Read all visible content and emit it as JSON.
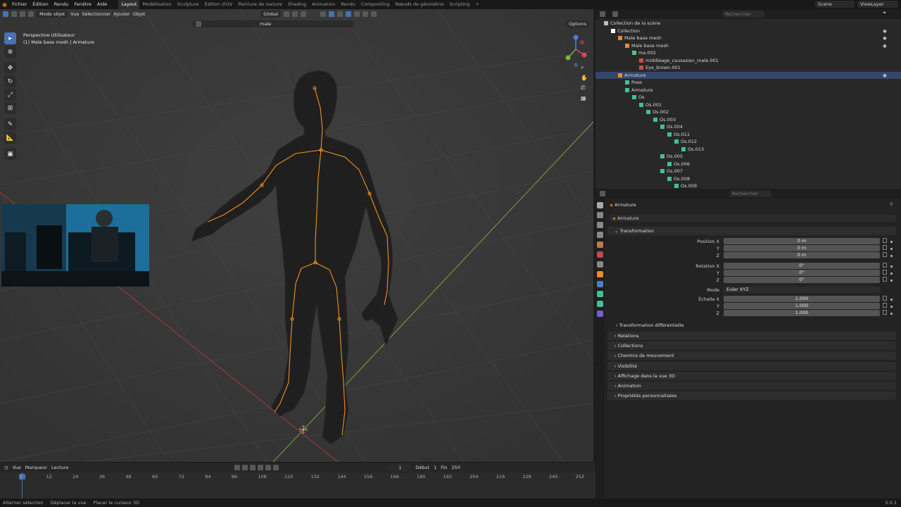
{
  "menu": [
    "Fichier",
    "Édition",
    "Rendu",
    "Fenêtre",
    "Aide"
  ],
  "workspaces": [
    "Layout",
    "Modélisation",
    "Sculpture",
    "Édition d'UV",
    "Peinture de texture",
    "Shading",
    "Animation",
    "Rendu",
    "Compositing",
    "Nœuds de géométrie",
    "Scripting"
  ],
  "active_workspace": "Layout",
  "scene_name": "Scene",
  "view_layer": "ViewLayer",
  "viewport": {
    "mode": "Mode objet",
    "menus": [
      "Vue",
      "Sélectionner",
      "Ajouter",
      "Objet"
    ],
    "orientation": "Global",
    "search_value": "male",
    "options": "Options",
    "info_line1": "Perspective Utilisateur",
    "info_line2": "(1) Male base mesh | Armature"
  },
  "outliner": {
    "search_placeholder": "Rechercher",
    "rows": [
      {
        "label": "Collection de la scène",
        "indent": 0,
        "color": "#bbbbbb"
      },
      {
        "label": "Collection",
        "indent": 1,
        "color": "#ffffff"
      },
      {
        "label": "Male base mesh",
        "indent": 2,
        "color": "#e88a2d"
      },
      {
        "label": "Male base mesh",
        "indent": 3,
        "color": "#e88a2d"
      },
      {
        "label": "ma.002",
        "indent": 4,
        "color": "#58c07a"
      },
      {
        "label": "middleage_causasian_male.001",
        "indent": 5,
        "color": "#cc4b4b"
      },
      {
        "label": "Eye_brown.001",
        "indent": 5,
        "color": "#cc4b4b"
      },
      {
        "label": "Armature",
        "indent": 2,
        "color": "#e88a2d",
        "selected": true
      },
      {
        "label": "Pose",
        "indent": 3,
        "color": "#3fbf9b"
      },
      {
        "label": "Armature",
        "indent": 3,
        "color": "#3fbf9b"
      },
      {
        "label": "Os",
        "indent": 4,
        "color": "#3fbf9b"
      },
      {
        "label": "Os.001",
        "indent": 5,
        "color": "#3fbf9b"
      },
      {
        "label": "Os.002",
        "indent": 6,
        "color": "#3fbf9b"
      },
      {
        "label": "Os.003",
        "indent": 7,
        "color": "#3fbf9b"
      },
      {
        "label": "Os.004",
        "indent": 8,
        "color": "#3fbf9b"
      },
      {
        "label": "Os.011",
        "indent": 9,
        "color": "#3fbf9b"
      },
      {
        "label": "Os.012",
        "indent": 10,
        "color": "#3fbf9b"
      },
      {
        "label": "Os.013",
        "indent": 11,
        "color": "#3fbf9b"
      },
      {
        "label": "Os.005",
        "indent": 8,
        "color": "#3fbf9b"
      },
      {
        "label": "Os.006",
        "indent": 9,
        "color": "#3fbf9b"
      },
      {
        "label": "Os.007",
        "indent": 8,
        "color": "#3fbf9b"
      },
      {
        "label": "Os.008",
        "indent": 9,
        "color": "#3fbf9b"
      },
      {
        "label": "Os.009",
        "indent": 10,
        "color": "#3fbf9b"
      }
    ]
  },
  "properties": {
    "search_placeholder": "Rechercher",
    "breadcrumb": "Armature",
    "object_name": "Armature",
    "transformation": "Transformation",
    "position_label": "Position X",
    "rotation_label": "Rotation X",
    "scale_label": "Échelle X",
    "y": "Y",
    "z": "Z",
    "position": [
      "0 m",
      "0 m",
      "0 m"
    ],
    "rotation": [
      "0°",
      "0°",
      "0°"
    ],
    "mode_label": "Mode",
    "mode_value": "Euler XYZ",
    "scale": [
      "1.000",
      "1.000",
      "1.000"
    ],
    "delta": "Transformation différentielle",
    "panels": [
      "Relations",
      "Collections",
      "Chemins de mouvement",
      "Visibilité",
      "Affichage dans la vue 3D",
      "Animation",
      "Propriétés personnalisées"
    ]
  },
  "timeline": {
    "menus": [
      "Vue",
      "Marqueur",
      "Lecture"
    ],
    "current_frame": "1",
    "start_label": "Début",
    "start": "1",
    "end_label": "Fin",
    "end": "250",
    "ticks": [
      "1",
      "12",
      "24",
      "36",
      "48",
      "60",
      "72",
      "84",
      "96",
      "108",
      "120",
      "132",
      "144",
      "156",
      "168",
      "180",
      "192",
      "204",
      "216",
      "228",
      "240",
      "252"
    ]
  },
  "status": {
    "items": [
      "Alterner sélection",
      "Déplacer la vue",
      "Placer le curseur 3D"
    ],
    "version": "5.0.1"
  },
  "colors": {
    "accent": "#4772b3",
    "armature": "#e88a2d",
    "bone": "#3fbf9b"
  }
}
